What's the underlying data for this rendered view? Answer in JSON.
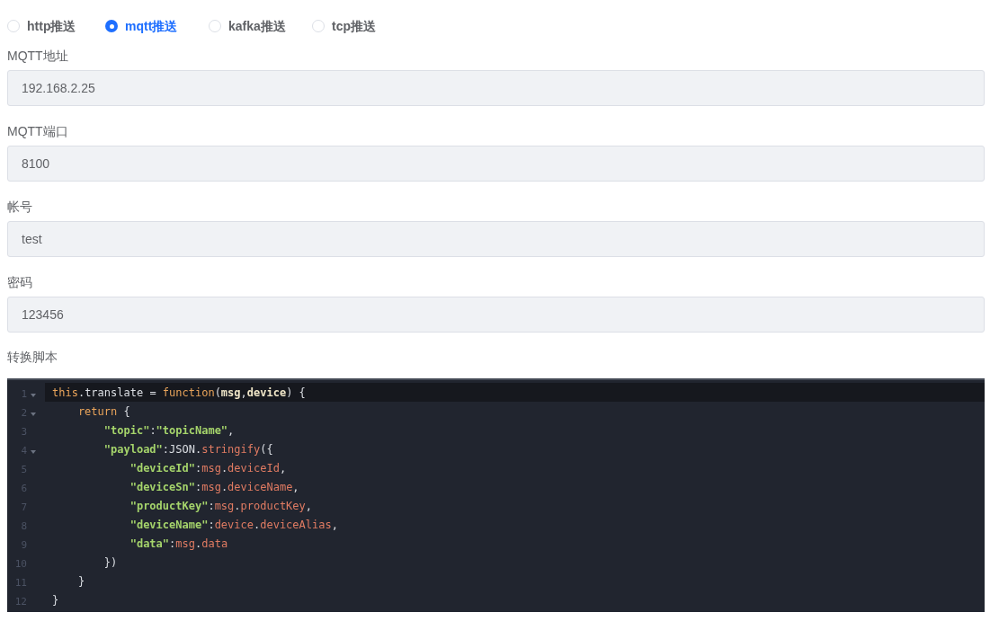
{
  "push_types": [
    {
      "label": "http推送",
      "selected": false
    },
    {
      "label": "mqtt推送",
      "selected": true
    },
    {
      "label": "kafka推送",
      "selected": false
    },
    {
      "label": "tcp推送",
      "selected": false
    }
  ],
  "fields": [
    {
      "label": "MQTT地址",
      "value": "192.168.2.25"
    },
    {
      "label": "MQTT端口",
      "value": "8100"
    },
    {
      "label": "帐号",
      "value": "test"
    },
    {
      "label": "密码",
      "value": "123456"
    }
  ],
  "script": {
    "label": "转换脚本",
    "lines": [
      {
        "number": "1",
        "fold": true,
        "active": true,
        "tokens": [
          {
            "kind": "keyword",
            "text": "this"
          },
          {
            "kind": "plain",
            "text": ".translate = "
          },
          {
            "kind": "keyword",
            "text": "function"
          },
          {
            "kind": "plain",
            "text": "("
          },
          {
            "kind": "param",
            "text": "msg"
          },
          {
            "kind": "plain",
            "text": ","
          },
          {
            "kind": "param",
            "text": "device"
          },
          {
            "kind": "plain",
            "text": ") {"
          }
        ]
      },
      {
        "number": "2",
        "fold": true,
        "active": false,
        "tokens": [
          {
            "kind": "keyword",
            "text": "    return"
          },
          {
            "kind": "plain",
            "text": " {"
          }
        ]
      },
      {
        "number": "3",
        "fold": false,
        "active": false,
        "tokens": [
          {
            "kind": "string",
            "text": "        \"topic\""
          },
          {
            "kind": "plain",
            "text": ":"
          },
          {
            "kind": "string",
            "text": "\"topicName\""
          },
          {
            "kind": "plain",
            "text": ","
          }
        ]
      },
      {
        "number": "4",
        "fold": true,
        "active": false,
        "tokens": [
          {
            "kind": "string",
            "text": "        \"payload\""
          },
          {
            "kind": "plain",
            "text": ":JSON."
          },
          {
            "kind": "member",
            "text": "stringify"
          },
          {
            "kind": "plain",
            "text": "({"
          }
        ]
      },
      {
        "number": "5",
        "fold": false,
        "active": false,
        "tokens": [
          {
            "kind": "string",
            "text": "            \"deviceId\""
          },
          {
            "kind": "plain",
            "text": ":"
          },
          {
            "kind": "member",
            "text": "msg"
          },
          {
            "kind": "plain",
            "text": "."
          },
          {
            "kind": "member",
            "text": "deviceId"
          },
          {
            "kind": "plain",
            "text": ","
          }
        ]
      },
      {
        "number": "6",
        "fold": false,
        "active": false,
        "tokens": [
          {
            "kind": "string",
            "text": "            \"deviceSn\""
          },
          {
            "kind": "plain",
            "text": ":"
          },
          {
            "kind": "member",
            "text": "msg"
          },
          {
            "kind": "plain",
            "text": "."
          },
          {
            "kind": "member",
            "text": "deviceName"
          },
          {
            "kind": "plain",
            "text": ","
          }
        ]
      },
      {
        "number": "7",
        "fold": false,
        "active": false,
        "tokens": [
          {
            "kind": "string",
            "text": "            \"productKey\""
          },
          {
            "kind": "plain",
            "text": ":"
          },
          {
            "kind": "member",
            "text": "msg"
          },
          {
            "kind": "plain",
            "text": "."
          },
          {
            "kind": "member",
            "text": "productKey"
          },
          {
            "kind": "plain",
            "text": ","
          }
        ]
      },
      {
        "number": "8",
        "fold": false,
        "active": false,
        "tokens": [
          {
            "kind": "string",
            "text": "            \"deviceName\""
          },
          {
            "kind": "plain",
            "text": ":"
          },
          {
            "kind": "member",
            "text": "device"
          },
          {
            "kind": "plain",
            "text": "."
          },
          {
            "kind": "member",
            "text": "deviceAlias"
          },
          {
            "kind": "plain",
            "text": ","
          }
        ]
      },
      {
        "number": "9",
        "fold": false,
        "active": false,
        "tokens": [
          {
            "kind": "string",
            "text": "            \"data\""
          },
          {
            "kind": "plain",
            "text": ":"
          },
          {
            "kind": "member",
            "text": "msg"
          },
          {
            "kind": "plain",
            "text": "."
          },
          {
            "kind": "member",
            "text": "data"
          }
        ]
      },
      {
        "number": "10",
        "fold": false,
        "active": false,
        "tokens": [
          {
            "kind": "plain",
            "text": "        })"
          }
        ]
      },
      {
        "number": "11",
        "fold": false,
        "active": false,
        "tokens": [
          {
            "kind": "plain",
            "text": "    }"
          }
        ]
      },
      {
        "number": "12",
        "fold": false,
        "active": false,
        "tokens": [
          {
            "kind": "plain",
            "text": "}"
          }
        ]
      }
    ]
  }
}
